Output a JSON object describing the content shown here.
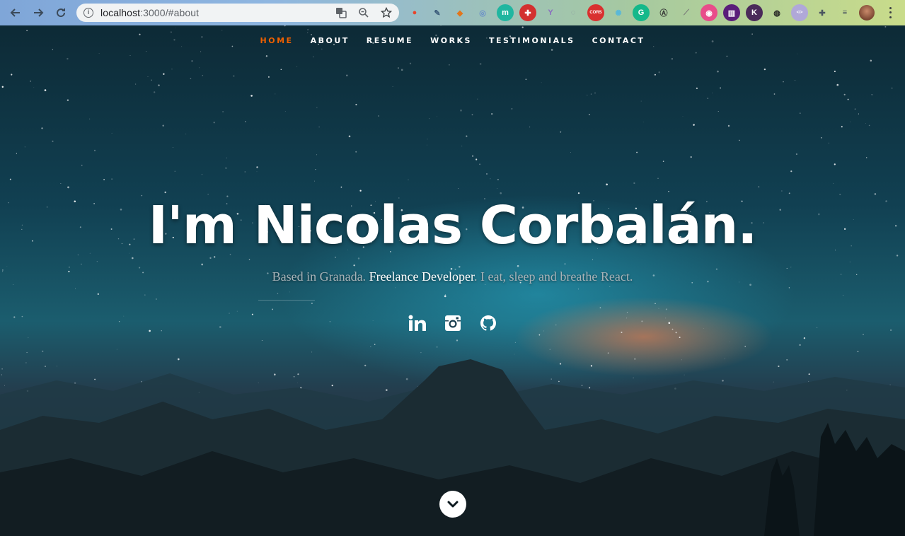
{
  "browser": {
    "url_host": "localhost",
    "url_rest": ":3000/#about",
    "extensions": [
      {
        "name": "fire-extension-icon",
        "bg": "transparent",
        "fg": "#e8452b",
        "glyph": "●"
      },
      {
        "name": "dropper-extension-icon",
        "bg": "transparent",
        "fg": "#3a5a7a",
        "glyph": "✎"
      },
      {
        "name": "metamask-extension-icon",
        "bg": "transparent",
        "fg": "#e2761b",
        "glyph": "◆"
      },
      {
        "name": "sync-extension-icon",
        "bg": "transparent",
        "fg": "#6a8fc8",
        "glyph": "◎"
      },
      {
        "name": "m-extension-icon",
        "bg": "#20b6a0",
        "fg": "#fff",
        "glyph": "m"
      },
      {
        "name": "puzzle-red-extension-icon",
        "bg": "#d3302f",
        "fg": "#fff",
        "glyph": "✚"
      },
      {
        "name": "y-extension-icon",
        "bg": "transparent",
        "fg": "#8a6fc0",
        "glyph": "Y"
      },
      {
        "name": "circle-extension-icon",
        "bg": "transparent",
        "fg": "#8a9aa0",
        "glyph": "◌"
      },
      {
        "name": "cors-extension-icon",
        "bg": "#d9302f",
        "fg": "#fff",
        "glyph": "CORS"
      },
      {
        "name": "gear-extension-icon",
        "bg": "transparent",
        "fg": "#5ab8d8",
        "glyph": "✺"
      },
      {
        "name": "grammarly-extension-icon",
        "bg": "#14b88a",
        "fg": "#fff",
        "glyph": "G"
      },
      {
        "name": "a-extension-icon",
        "bg": "transparent",
        "fg": "#333",
        "glyph": "Ⓐ"
      },
      {
        "name": "ruler-extension-icon",
        "bg": "transparent",
        "fg": "#777",
        "glyph": "⟋"
      },
      {
        "name": "pink-extension-icon",
        "bg": "#e84d8a",
        "fg": "#fff",
        "glyph": "◉"
      },
      {
        "name": "chart-extension-icon",
        "bg": "#5a1e7a",
        "fg": "#fff",
        "glyph": "▥"
      },
      {
        "name": "k-extension-icon",
        "bg": "#4a2a5a",
        "fg": "#fff",
        "glyph": "K"
      },
      {
        "name": "loop-extension-icon",
        "bg": "transparent",
        "fg": "#222",
        "glyph": "◍"
      },
      {
        "name": "code-extension-icon",
        "bg": "#b0a8d8",
        "fg": "#fff",
        "glyph": "</>"
      },
      {
        "name": "puzzle-extension-icon",
        "bg": "transparent",
        "fg": "#4a5560",
        "glyph": "✚"
      },
      {
        "name": "media-extension-icon",
        "bg": "transparent",
        "fg": "#4a5560",
        "glyph": "≡"
      }
    ]
  },
  "nav": {
    "items": [
      {
        "label": "HOME",
        "active": true
      },
      {
        "label": "ABOUT",
        "active": false
      },
      {
        "label": "RESUME",
        "active": false
      },
      {
        "label": "WORKS",
        "active": false
      },
      {
        "label": "TESTIMONIALS",
        "active": false
      },
      {
        "label": "CONTACT",
        "active": false
      }
    ],
    "active_color": "#f06000"
  },
  "hero": {
    "headline": "I'm Nicolas Corbalán.",
    "tagline_prefix": "Based in Granada. ",
    "tagline_strong": "Freelance Developer",
    "tagline_suffix": ". I eat, sleep and breathe React.",
    "socials": [
      "linkedin-icon",
      "instagram-icon",
      "github-icon"
    ],
    "scroll_icon": "chevron-down-icon"
  }
}
